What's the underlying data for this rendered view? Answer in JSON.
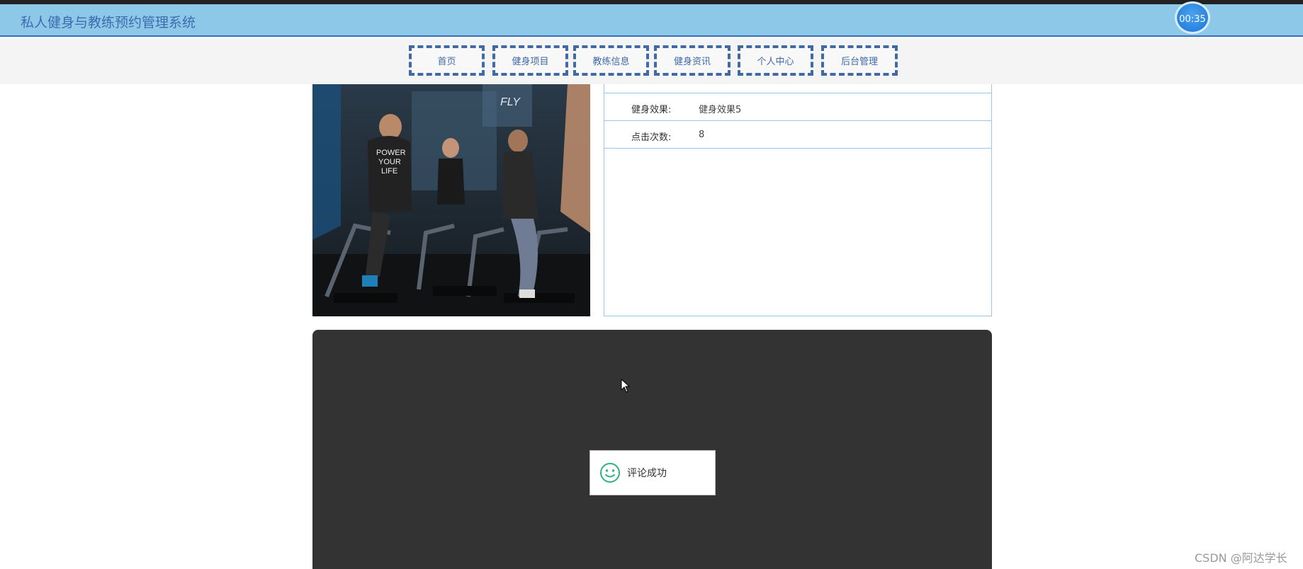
{
  "header": {
    "title": "私人健身与教练预约管理系统",
    "timer": "00:35"
  },
  "nav": {
    "items": [
      "首页",
      "健身项目",
      "教练信息",
      "健身资讯",
      "个人中心",
      "后台管理"
    ]
  },
  "details": {
    "rows": [
      {
        "label": "健身效果:",
        "value": "健身效果5"
      },
      {
        "label": "点击次数:",
        "value": "8"
      }
    ]
  },
  "photo": {
    "alt": "健身项目图片",
    "shirt_text": [
      "POWER",
      "YOUR",
      "LIFE"
    ],
    "logo": "FLY"
  },
  "toast": {
    "message": "评论成功"
  },
  "watermark": "CSDN @阿达学长",
  "colors": {
    "header_bg": "#8ec8e8",
    "nav_border": "#3f6aa6",
    "panel_border": "#9cc6ec",
    "dark_panel": "#333333"
  }
}
